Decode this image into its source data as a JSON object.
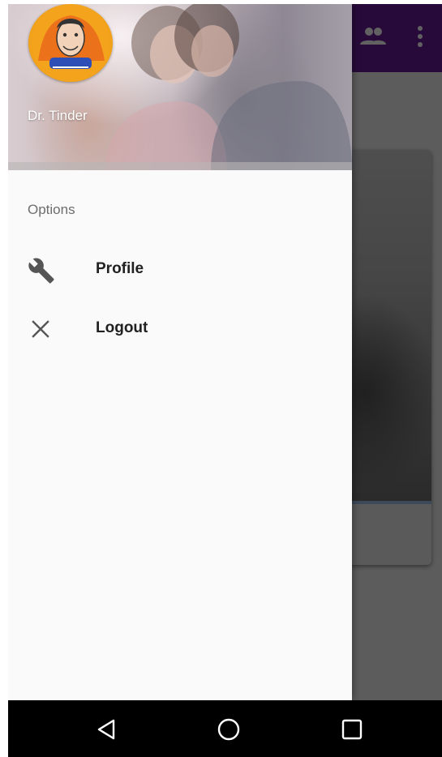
{
  "drawer": {
    "header": {
      "user_name": "Dr. Tinder"
    },
    "section_label": "Options",
    "items": [
      {
        "label": "Profile",
        "icon": "wrench-icon"
      },
      {
        "label": "Logout",
        "icon": "close-icon"
      }
    ]
  },
  "app_bar": {
    "icons": [
      "people-icon",
      "more-vert-icon"
    ]
  },
  "nav_bar": {
    "buttons": [
      "back-icon",
      "home-icon",
      "recents-icon"
    ]
  },
  "colors": {
    "app_bar": "#6a1b9a",
    "drawer_background": "#fafafa",
    "scrim": "rgba(0,0,0,0.62)",
    "nav_bar": "#000000"
  }
}
